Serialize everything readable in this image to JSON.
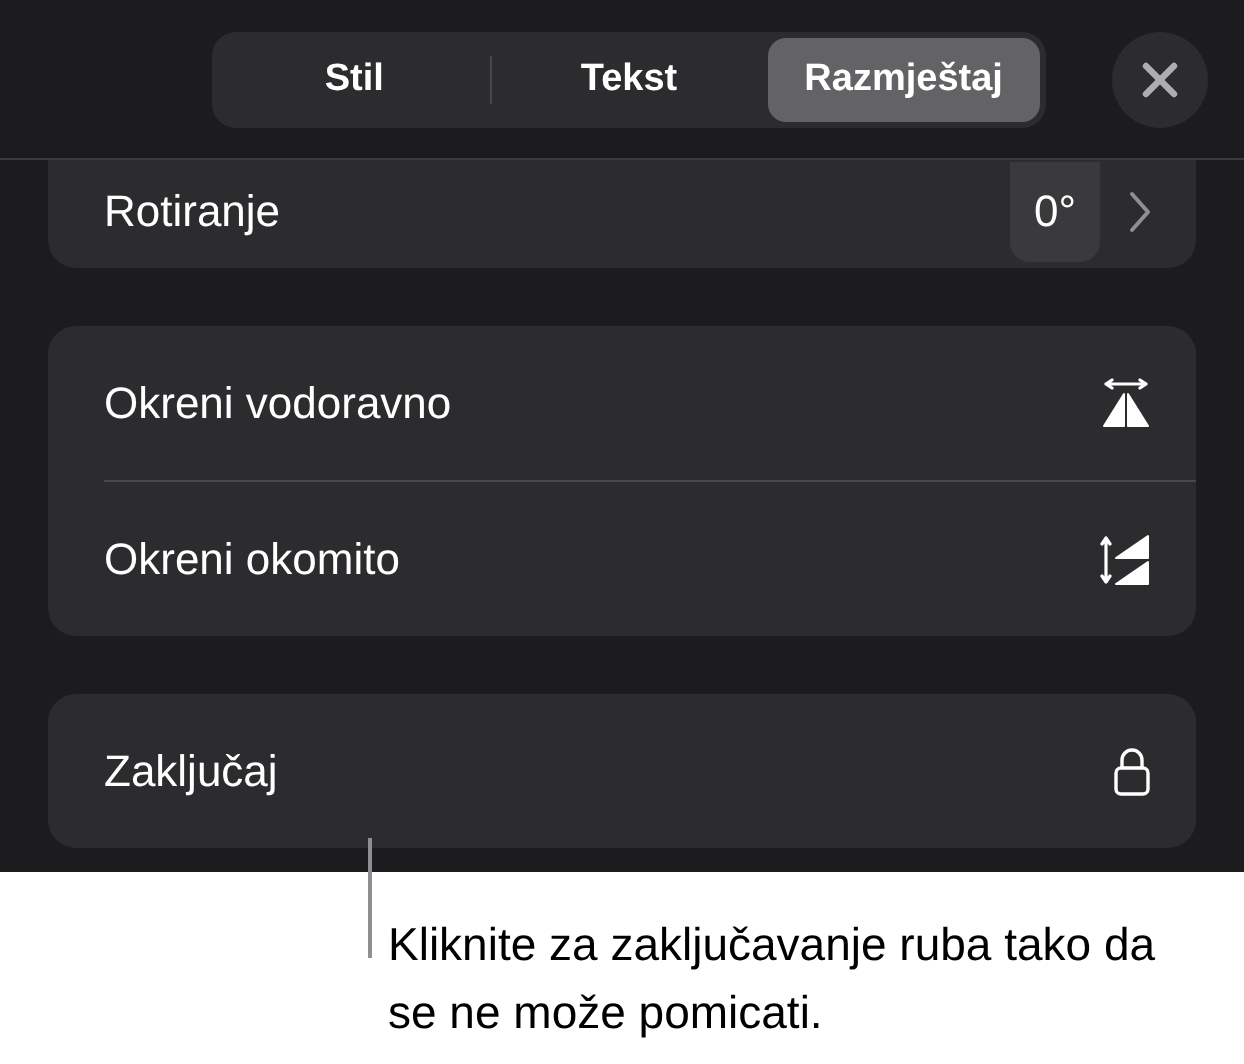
{
  "tabs": [
    {
      "label": "Stil",
      "selected": false
    },
    {
      "label": "Tekst",
      "selected": false
    },
    {
      "label": "Razmještaj",
      "selected": true
    }
  ],
  "groups": [
    {
      "cut_top": true,
      "rows": [
        {
          "kind": "value",
          "label": "Rotiranje",
          "value": "0°"
        }
      ]
    },
    {
      "cut_top": false,
      "rows": [
        {
          "kind": "flip-horizontal",
          "label": "Okreni vodoravno"
        },
        {
          "kind": "flip-vertical",
          "label": "Okreni okomito"
        }
      ]
    },
    {
      "cut_top": false,
      "rows": [
        {
          "kind": "lock",
          "label": "Zaključaj"
        }
      ]
    }
  ],
  "callout": "Kliknite za zaključavanje ruba tako da se ne može pomicati."
}
